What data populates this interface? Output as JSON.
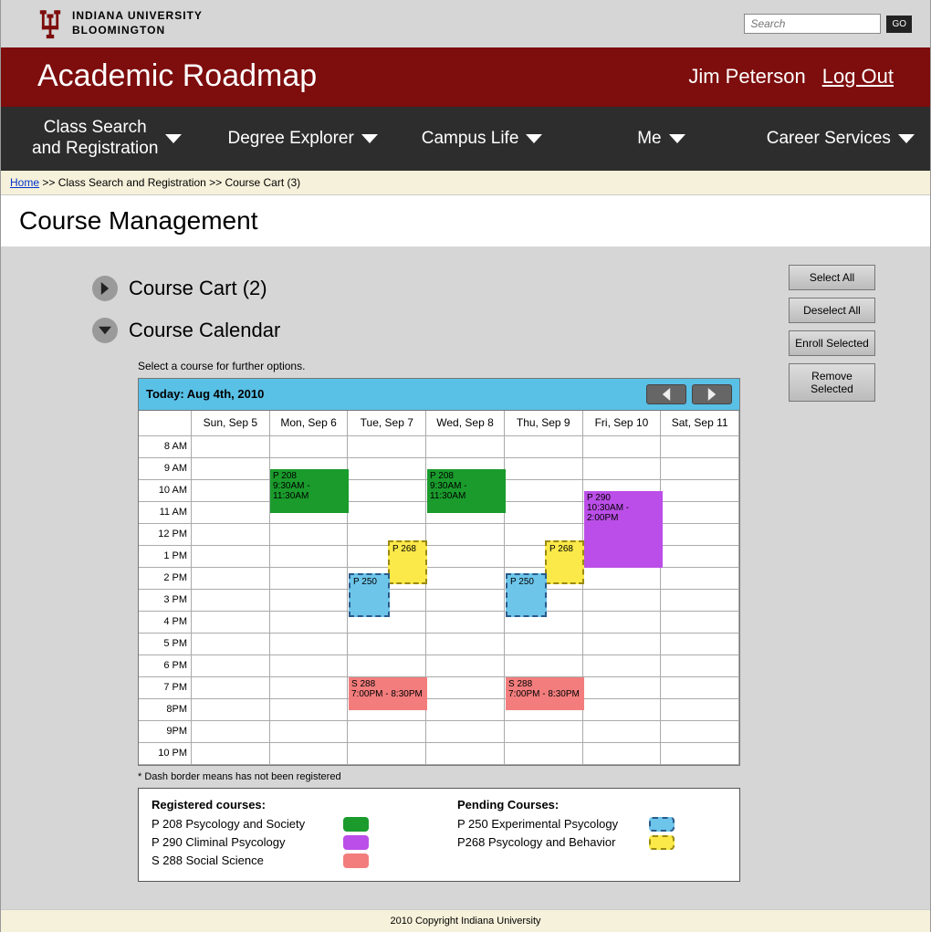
{
  "brand": {
    "line1": "INDIANA UNIVERSITY",
    "line2": "BLOOMINGTON"
  },
  "search": {
    "placeholder": "Search",
    "go": "GO"
  },
  "app": {
    "title": "Academic Roadmap"
  },
  "user": {
    "name": "Jim Peterson",
    "logout": "Log Out"
  },
  "nav": {
    "items": [
      "Class Search\nand Registration",
      "Degree Explorer",
      "Campus Life",
      "Me",
      "Career Services"
    ]
  },
  "breadcrumb": {
    "home": "Home",
    "sep": " >> ",
    "mid": "Class Search and Registration",
    "tail": "Course Cart (3)"
  },
  "page_title": "Course Management",
  "sections": {
    "cart": "Course Cart (2)",
    "calendar": "Course Calendar"
  },
  "actions": {
    "select_all": "Select All",
    "deselect_all": "Deselect All",
    "enroll": "Enroll Selected",
    "remove": "Remove Selected"
  },
  "instruction": "Select a course for further options.",
  "calendar": {
    "today_label": "Today: Aug 4th, 2010",
    "days": [
      "Sun, Sep 5",
      "Mon, Sep 6",
      "Tue, Sep 7",
      "Wed, Sep 8",
      "Thu, Sep 9",
      "Fri, Sep 10",
      "Sat, Sep 11"
    ],
    "hours": [
      "8 AM",
      "9 AM",
      "10 AM",
      "11 AM",
      "12 PM",
      "1 PM",
      "2 PM",
      "3 PM",
      "4 PM",
      "5 PM",
      "6 PM",
      "7 PM",
      "8PM",
      "9PM",
      "10 PM"
    ]
  },
  "events": {
    "p208_mon": "P 208\n9:30AM - 11:30AM",
    "p208_wed": "P 208\n9:30AM - 11:30AM",
    "p290_fri": "P 290\n10:30AM - 2:00PM",
    "p268_tue": "P 268",
    "p268_thu": "P 268",
    "p250_tue": "P 250",
    "p250_thu": "P 250",
    "s288_tue": "S 288\n7:00PM - 8:30PM",
    "s288_thu": "S 288\n7:00PM - 8:30PM"
  },
  "footnote": "* Dash border means has not been registered",
  "legend": {
    "reg_head": "Registered courses:",
    "pend_head": "Pending Courses:",
    "p208": "P 208 Psycology and Society",
    "p290": "P 290 Climinal Psycology",
    "s288": "S 288 Social Science",
    "p250": "P 250 Experimental Psycology",
    "p268": "P268 Psycology and Behavior"
  },
  "footer": "2010 Copyright Indiana University"
}
